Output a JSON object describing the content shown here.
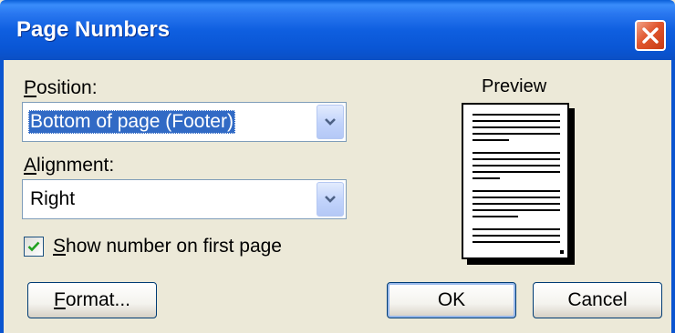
{
  "window": {
    "title": "Page Numbers"
  },
  "position": {
    "label_prefix": "P",
    "label_rest": "osition:",
    "selected": "Bottom of page (Footer)"
  },
  "alignment": {
    "label_prefix": "A",
    "label_rest": "lignment:",
    "selected": "Right"
  },
  "show_first_page": {
    "label_prefix": "S",
    "label_rest": "how number on first page",
    "checked": true
  },
  "preview": {
    "label": "Preview"
  },
  "buttons": {
    "format_prefix": "F",
    "format_rest": "ormat...",
    "ok": "OK",
    "cancel": "Cancel"
  }
}
